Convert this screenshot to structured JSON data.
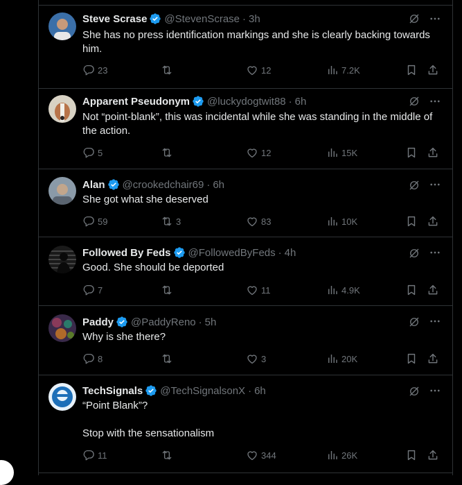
{
  "tweets": [
    {
      "name": "Steve Scrase",
      "handle": "@StevenScrase",
      "time": "3h",
      "text": "She has no press identification markings and she is clearly backing towards him.",
      "replies": "23",
      "retweets": "",
      "likes": "12",
      "views": "7.2K",
      "avatar_color": "#3b6fa8"
    },
    {
      "name": "Apparent Pseudonym",
      "handle": "@luckydogtwit88",
      "time": "6h",
      "text": "Not “point-blank”, this was incidental while she was standing in the middle of the action.",
      "replies": "5",
      "retweets": "",
      "likes": "12",
      "views": "15K",
      "avatar_color": "#b8744a"
    },
    {
      "name": "Alan",
      "handle": "@crookedchair69",
      "time": "6h",
      "text": "She got what she deserved",
      "replies": "59",
      "retweets": "3",
      "likes": "83",
      "views": "10K",
      "avatar_color": "#8a9aa8"
    },
    {
      "name": "Followed By Feds",
      "handle": "@FollowedByFeds",
      "time": "4h",
      "text": "Good. She should be deported",
      "replies": "7",
      "retweets": "",
      "likes": "11",
      "views": "4.9K",
      "avatar_color": "#333333"
    },
    {
      "name": "Paddy",
      "handle": "@PaddyReno",
      "time": "5h",
      "text": "Why is she there?",
      "replies": "8",
      "retweets": "",
      "likes": "3",
      "views": "20K",
      "avatar_color": "#6a3a5a"
    },
    {
      "name": "TechSignals",
      "handle": "@TechSignalsonX",
      "time": "6h",
      "text_line1": "“Point Blank”?",
      "text_line2": "Stop with the sensationalism",
      "replies": "11",
      "retweets": "",
      "likes": "344",
      "views": "26K",
      "avatar_color": "#1d6fb8"
    }
  ],
  "colors": {
    "background": "#000000",
    "text": "#e7e9ea",
    "secondary": "#71767b",
    "verified": "#1d9bf0",
    "border": "#2f3336"
  }
}
